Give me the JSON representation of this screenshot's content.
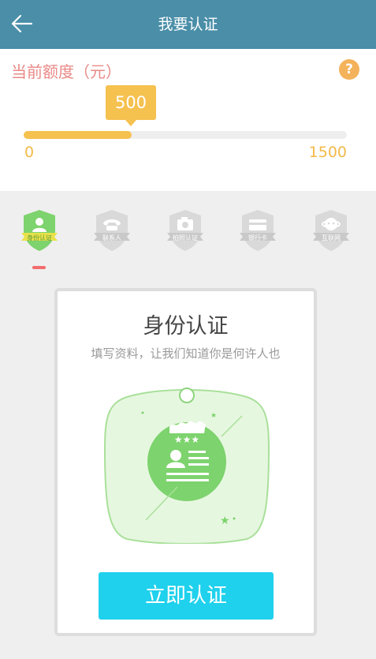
{
  "header": {
    "title": "我要认证",
    "back_icon": "arrow-left-icon"
  },
  "quota": {
    "label": "当前额度（元）",
    "help_symbol": "?",
    "current": "500",
    "min": "0",
    "max": "1500",
    "fill_fraction": 0.333,
    "accent_color": "#f5c14f"
  },
  "steps": [
    {
      "label": "身份认证",
      "icon": "person-icon",
      "active": true
    },
    {
      "label": "联系人",
      "icon": "phone-icon",
      "active": false
    },
    {
      "label": "拍照认证",
      "icon": "camera-icon",
      "active": false
    },
    {
      "label": "银行卡",
      "icon": "bank-card-icon",
      "active": false
    },
    {
      "label": "互联网",
      "icon": "internet-icon",
      "active": false
    }
  ],
  "card": {
    "title": "身份认证",
    "subtitle": "填写资料，让我们知道你是何许人也",
    "button_label": "立即认证"
  }
}
